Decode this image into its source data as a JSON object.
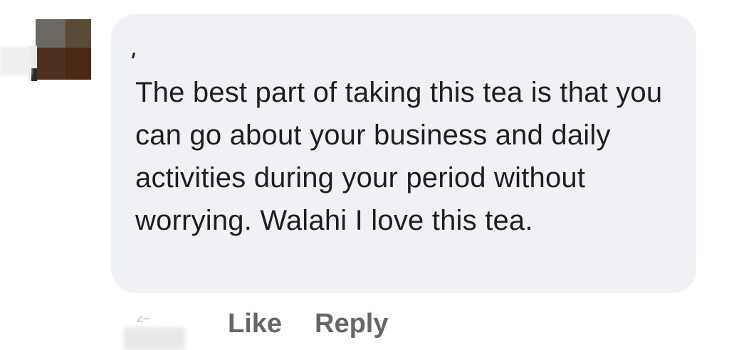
{
  "comment": {
    "text": "The best part of taking this tea is that you can go about your business and daily activities during your period without worrying. Walahi I love this tea.",
    "time_partial": "2–"
  },
  "actions": {
    "like_label": "Like",
    "reply_label": "Reply"
  },
  "colors": {
    "bubble_bg": "#f0f1f4",
    "text": "#1c1e21",
    "action_text": "#65676b"
  }
}
